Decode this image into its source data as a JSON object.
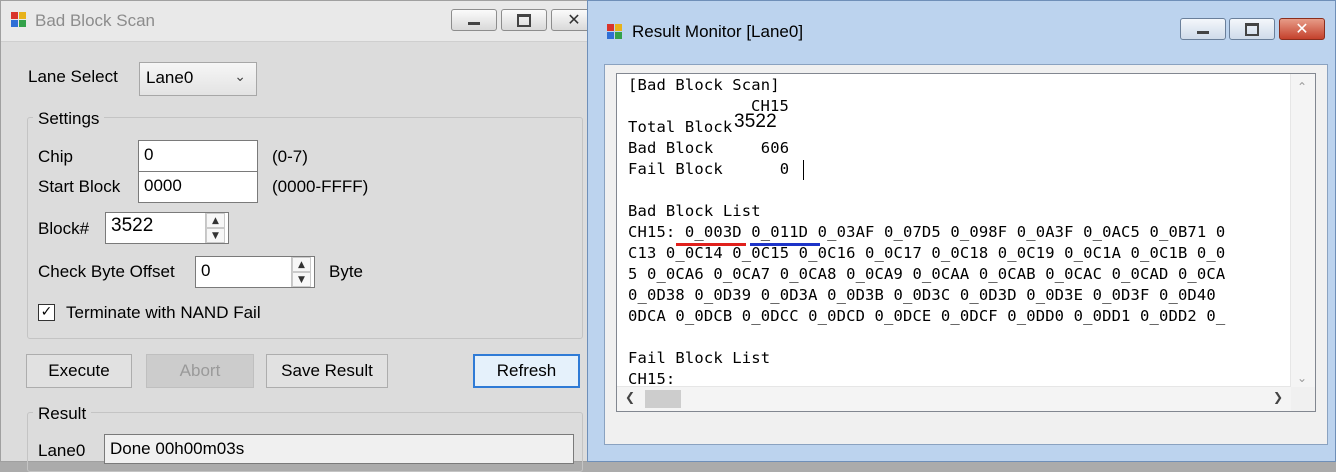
{
  "bad_block_scan": {
    "title": "Bad Block Scan",
    "lane_select": {
      "label": "Lane Select",
      "value": "Lane0"
    },
    "settings": {
      "group_label": "Settings",
      "chip": {
        "label": "Chip",
        "value": "0",
        "range": "(0-7)"
      },
      "start_block": {
        "label": "Start Block",
        "value": "0000",
        "range": "(0000-FFFF)"
      },
      "block_count": {
        "label": "Block#",
        "value": "3522"
      },
      "check_byte_offset": {
        "label": "Check Byte Offset",
        "value": "0",
        "unit": "Byte"
      },
      "terminate": {
        "label": "Terminate with NAND Fail",
        "checked": true
      }
    },
    "buttons": {
      "execute": "Execute",
      "abort": "Abort",
      "save_result": "Save Result",
      "refresh": "Refresh"
    },
    "result": {
      "group_label": "Result",
      "lane_label": "Lane0",
      "value": "Done 00h00m03s"
    }
  },
  "result_monitor": {
    "title": "Result Monitor [Lane0]",
    "lines": [
      "[Bad Block Scan]",
      "CH15",
      "Total Block",
      "3522",
      "Bad Block     606",
      "Fail Block      0",
      "Bad Block List",
      "CH15: 0_003D 0_011D 0_03AF 0_07D5 0_098F 0_0A3F 0_0AC5 0_0B71 0",
      "C13 0_0C14 0_0C15 0_0C16 0_0C17 0_0C18 0_0C19 0_0C1A 0_0C1B 0_0",
      "5 0_0CA6 0_0CA7 0_0CA8 0_0CA9 0_0CAA 0_0CAB 0_0CAC 0_0CAD 0_0CA",
      "0_0D38 0_0D39 0_0D3A 0_0D3B 0_0D3C 0_0D3D 0_0D3E 0_0D3F 0_0D40",
      "0DCA 0_0DCB 0_0DCC 0_0DCD 0_0DCE 0_0DCF 0_0DD0 0_0DD1 0_0DD2 0_",
      "Fail Block List",
      "CH15:"
    ],
    "highlights": {
      "first_underline_color": "#e0201c",
      "second_underline_color": "#1c33c8"
    }
  },
  "icons": {
    "app": "app-icon",
    "minimize": "minimize-icon",
    "maximize": "maximize-icon",
    "close": "close-icon",
    "dropdown": "chevron-down-icon",
    "spin_up": "spin-up-icon",
    "spin_down": "spin-down-icon",
    "check": "checkmark-icon",
    "scroll_up": "scroll-up-icon",
    "scroll_down": "scroll-down-icon",
    "scroll_left": "scroll-left-icon",
    "scroll_right": "scroll-right-icon"
  }
}
